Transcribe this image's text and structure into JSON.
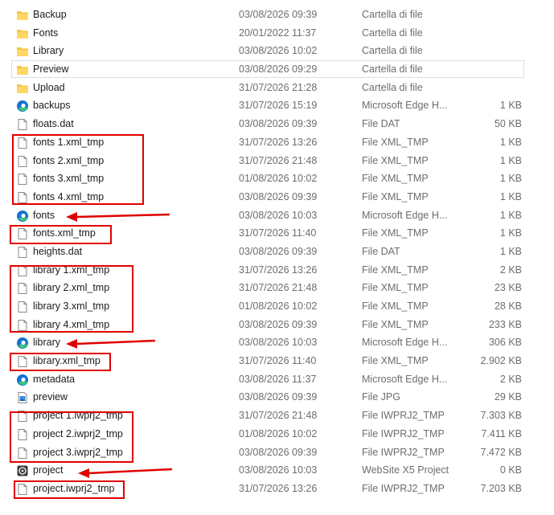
{
  "files": [
    {
      "name": "Backup",
      "date": "03/08/2026 09:39",
      "type": "Cartella di file",
      "size": "",
      "icon": "folder-icon"
    },
    {
      "name": "Fonts",
      "date": "20/01/2022 11:37",
      "type": "Cartella di file",
      "size": "",
      "icon": "folder-icon"
    },
    {
      "name": "Library",
      "date": "03/08/2026 10:02",
      "type": "Cartella di file",
      "size": "",
      "icon": "folder-icon"
    },
    {
      "name": "Preview",
      "date": "03/08/2026 09:29",
      "type": "Cartella di file",
      "size": "",
      "icon": "folder-icon"
    },
    {
      "name": "Upload",
      "date": "31/07/2026 21:28",
      "type": "Cartella di file",
      "size": "",
      "icon": "folder-icon"
    },
    {
      "name": "backups",
      "date": "31/07/2026 15:19",
      "type": "Microsoft Edge H...",
      "size": "1 KB",
      "icon": "edge-icon"
    },
    {
      "name": "floats.dat",
      "date": "03/08/2026 09:39",
      "type": "File DAT",
      "size": "50 KB",
      "icon": "file-icon"
    },
    {
      "name": "fonts 1.xml_tmp",
      "date": "31/07/2026 13:26",
      "type": "File XML_TMP",
      "size": "1 KB",
      "icon": "file-icon"
    },
    {
      "name": "fonts 2.xml_tmp",
      "date": "31/07/2026 21:48",
      "type": "File XML_TMP",
      "size": "1 KB",
      "icon": "file-icon"
    },
    {
      "name": "fonts 3.xml_tmp",
      "date": "01/08/2026 10:02",
      "type": "File XML_TMP",
      "size": "1 KB",
      "icon": "file-icon"
    },
    {
      "name": "fonts 4.xml_tmp",
      "date": "03/08/2026 09:39",
      "type": "File XML_TMP",
      "size": "1 KB",
      "icon": "file-icon"
    },
    {
      "name": "fonts",
      "date": "03/08/2026 10:03",
      "type": "Microsoft Edge H...",
      "size": "1 KB",
      "icon": "edge-icon"
    },
    {
      "name": "fonts.xml_tmp",
      "date": "31/07/2026 11:40",
      "type": "File XML_TMP",
      "size": "1 KB",
      "icon": "file-icon"
    },
    {
      "name": "heights.dat",
      "date": "03/08/2026 09:39",
      "type": "File DAT",
      "size": "1 KB",
      "icon": "file-icon"
    },
    {
      "name": "library 1.xml_tmp",
      "date": "31/07/2026 13:26",
      "type": "File XML_TMP",
      "size": "2 KB",
      "icon": "file-icon"
    },
    {
      "name": "library 2.xml_tmp",
      "date": "31/07/2026 21:48",
      "type": "File XML_TMP",
      "size": "23 KB",
      "icon": "file-icon"
    },
    {
      "name": "library 3.xml_tmp",
      "date": "01/08/2026 10:02",
      "type": "File XML_TMP",
      "size": "28 KB",
      "icon": "file-icon"
    },
    {
      "name": "library 4.xml_tmp",
      "date": "03/08/2026 09:39",
      "type": "File XML_TMP",
      "size": "233 KB",
      "icon": "file-icon"
    },
    {
      "name": "library",
      "date": "03/08/2026 10:03",
      "type": "Microsoft Edge H...",
      "size": "306 KB",
      "icon": "edge-icon"
    },
    {
      "name": "library.xml_tmp",
      "date": "31/07/2026 11:40",
      "type": "File XML_TMP",
      "size": "2.902 KB",
      "icon": "file-icon"
    },
    {
      "name": "metadata",
      "date": "03/08/2026 11:37",
      "type": "Microsoft Edge H...",
      "size": "2 KB",
      "icon": "edge-icon"
    },
    {
      "name": "preview",
      "date": "03/08/2026 09:39",
      "type": "File JPG",
      "size": "29 KB",
      "icon": "image-file-icon"
    },
    {
      "name": "project 1.iwprj2_tmp",
      "date": "31/07/2026 21:48",
      "type": "File IWPRJ2_TMP",
      "size": "7.303 KB",
      "icon": "file-icon"
    },
    {
      "name": "project 2.iwprj2_tmp",
      "date": "01/08/2026 10:02",
      "type": "File IWPRJ2_TMP",
      "size": "7.411 KB",
      "icon": "file-icon"
    },
    {
      "name": "project 3.iwprj2_tmp",
      "date": "03/08/2026 09:39",
      "type": "File IWPRJ2_TMP",
      "size": "7.472 KB",
      "icon": "file-icon"
    },
    {
      "name": "project",
      "date": "03/08/2026 10:03",
      "type": "WebSite X5 Project",
      "size": "0 KB",
      "icon": "x5-project-icon"
    },
    {
      "name": "project.iwprj2_tmp",
      "date": "31/07/2026 13:26",
      "type": "File IWPRJ2_TMP",
      "size": "7.203 KB",
      "icon": "file-icon"
    }
  ],
  "focused_row": "Preview",
  "colors": {
    "annotation": "#e00000",
    "folder": "#f5c542",
    "edge_blue": "#1173d4",
    "edge_green": "#3ccb6e",
    "secondary_text": "#6d6d6d"
  }
}
